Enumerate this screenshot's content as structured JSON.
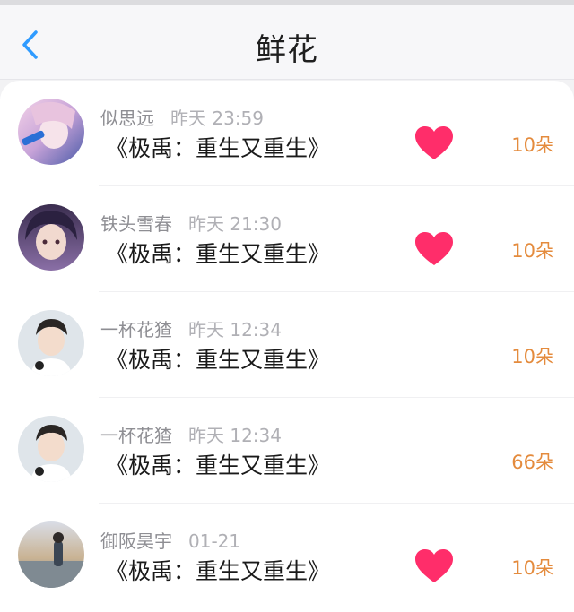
{
  "header": {
    "title": "鲜花",
    "back_icon": "chevron-left-icon",
    "accent": "#2f9bff"
  },
  "colors": {
    "heart": "#ff2d6a",
    "count": "#e48b3d"
  },
  "rows": [
    {
      "name": "似思远",
      "time": "昨天 23:59",
      "book": "《极禹：重生又重生》",
      "heart": true,
      "count": "10朵",
      "avatar_hue": "#d9b8e6"
    },
    {
      "name": "铁头雪春",
      "time": "昨天 21:30",
      "book": "《极禹：重生又重生》",
      "heart": true,
      "count": "10朵",
      "avatar_hue": "#6b5a86"
    },
    {
      "name": "一杯花猹",
      "time": "昨天 12:34",
      "book": "《极禹：重生又重生》",
      "heart": false,
      "count": "10朵",
      "avatar_hue": "#cdd6de"
    },
    {
      "name": "一杯花猹",
      "time": "昨天 12:34",
      "book": "《极禹：重生又重生》",
      "heart": false,
      "count": "66朵",
      "avatar_hue": "#cdd6de"
    },
    {
      "name": "御阪昊宇",
      "time": "01-21",
      "book": "《极禹：重生又重生》",
      "heart": true,
      "count": "10朵",
      "avatar_hue": "#bfa98a"
    }
  ]
}
